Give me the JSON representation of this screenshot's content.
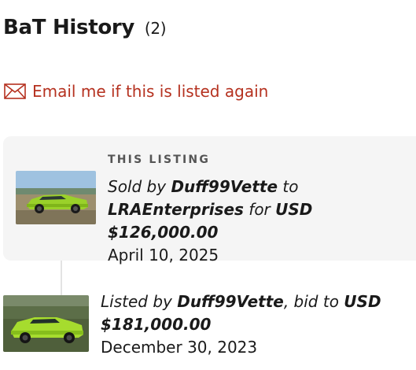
{
  "history": {
    "title": "BaT History",
    "count": "(2)"
  },
  "email_alert": {
    "icon": "envelope-icon",
    "label": "Email me if this is listed again",
    "color": "#b5311f"
  },
  "this_listing": {
    "heading": "THIS LISTING",
    "sold_by_prefix": "Sold by",
    "seller": "Duff99Vette",
    "to_word": "to",
    "buyer": "LRAEnterprises",
    "for_word": "for",
    "price": "USD $126,000.00",
    "date": "April 10, 2025"
  },
  "previous_listing": {
    "listed_by_prefix": "Listed by",
    "seller": "Duff99Vette",
    "bid_to": ", bid to",
    "price_currency": "USD",
    "price": "$181,000.00",
    "date": "December 30, 2023"
  }
}
